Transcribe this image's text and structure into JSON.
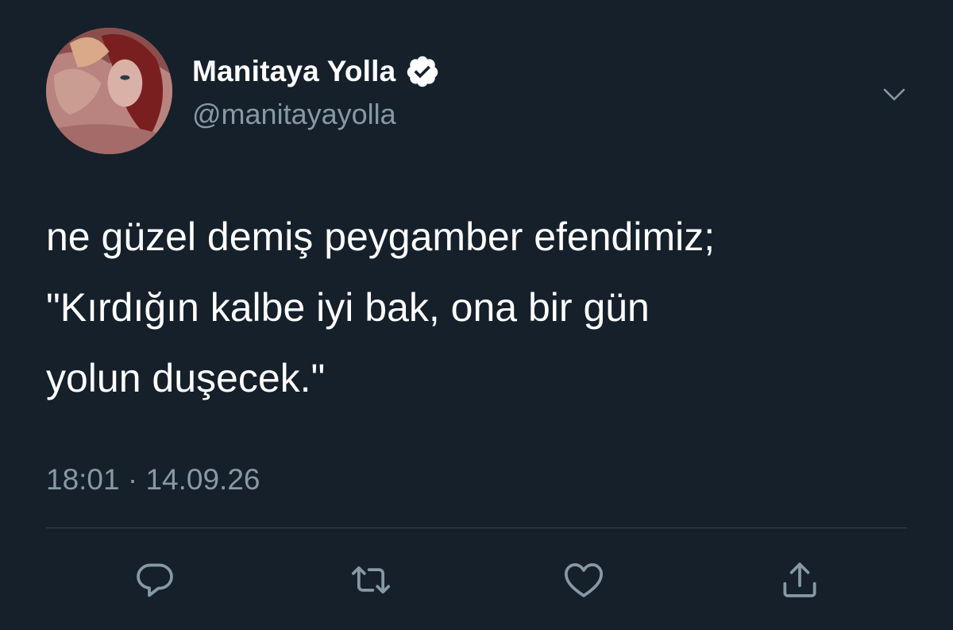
{
  "author": {
    "display_name": "Manitaya Yolla",
    "handle": "@manitayayolla",
    "verified": true
  },
  "tweet": {
    "lines": [
      "ne güzel demiş peygamber efendimiz;",
      "\"Kırdığın kalbe iyi bak, ona bir gün",
      "yolun duşecek.\""
    ],
    "timestamp": "18:01 · 14.09.26"
  },
  "icons": {
    "caret": "chevron-down-icon",
    "verified": "verified-badge-icon",
    "reply": "reply-icon",
    "retweet": "retweet-icon",
    "like": "heart-icon",
    "share": "share-icon"
  },
  "colors": {
    "background": "#15202b",
    "primary_text": "#ffffff",
    "secondary_text": "#8899a6",
    "divider": "#38444d"
  }
}
